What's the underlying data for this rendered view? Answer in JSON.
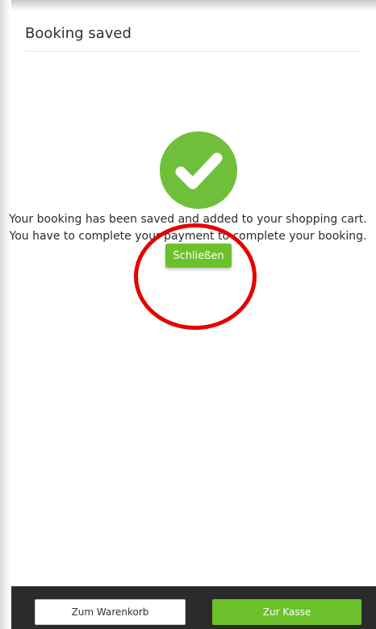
{
  "dialog": {
    "title": "Booking saved",
    "icon": "check-circle-icon",
    "message_line1": "Your booking has been saved and added to your shopping cart.",
    "message_line2": "You have to complete your payment to complete your booking.",
    "close_label": "Schließen"
  },
  "footer": {
    "cart_label": "Zum Warenkorb",
    "checkout_label": "Zur Kasse"
  },
  "colors": {
    "accent_green": "#6cc12b",
    "check_green": "#6fbf3a",
    "footer_bg": "#2b2b2b",
    "annotation_red": "#e60000"
  }
}
